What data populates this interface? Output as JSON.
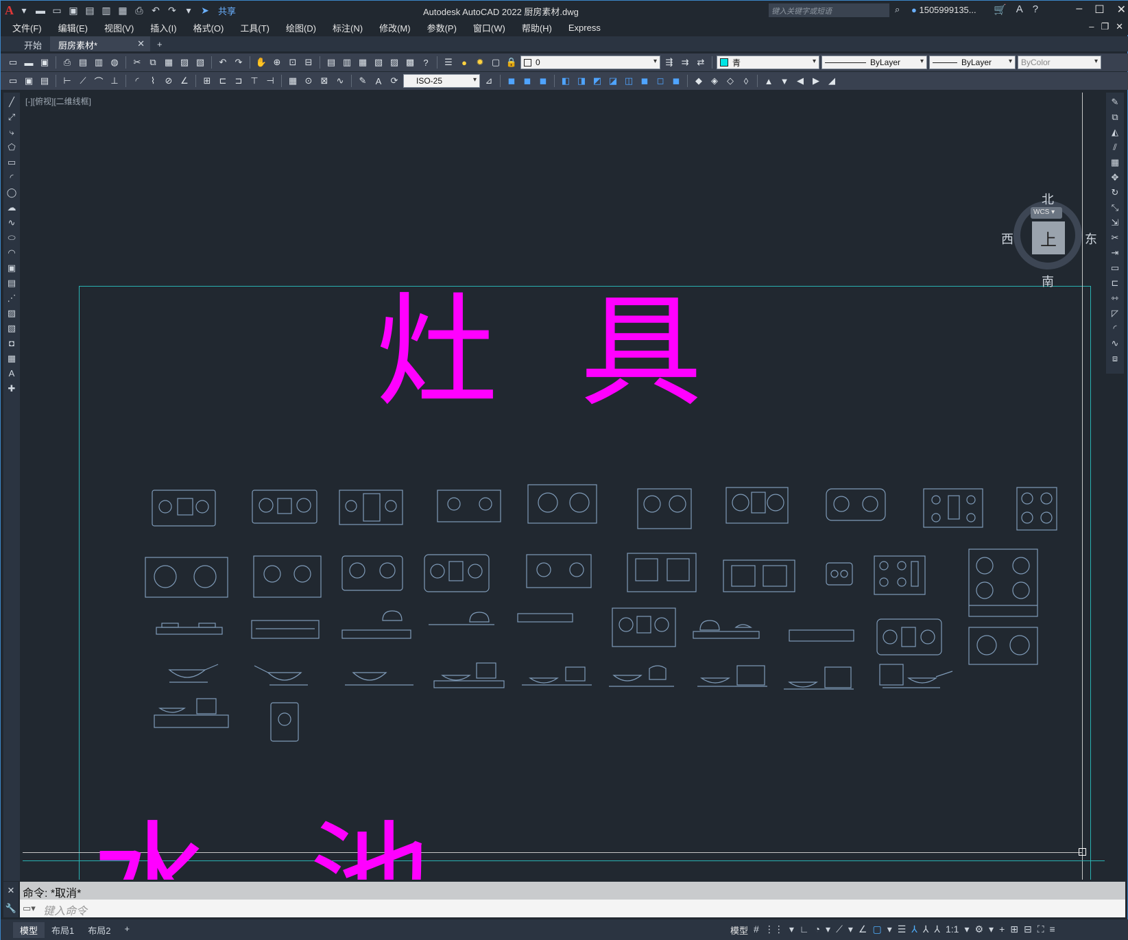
{
  "titlebar": {
    "logo": "A",
    "share_label": "共享",
    "app_title": "Autodesk AutoCAD 2022    厨房素材.dwg",
    "search_placeholder": "键入关键字或短语",
    "user": "1505999135...",
    "quick_access_icons": [
      "new-icon",
      "open-icon",
      "save-icon",
      "saveas-icon",
      "plot-preview-icon",
      "publish-icon",
      "print-icon",
      "undo-icon",
      "redo-icon"
    ]
  },
  "menu": {
    "items": [
      "文件(F)",
      "编辑(E)",
      "视图(V)",
      "插入(I)",
      "格式(O)",
      "工具(T)",
      "绘图(D)",
      "标注(N)",
      "修改(M)",
      "参数(P)",
      "窗口(W)",
      "帮助(H)",
      "Express"
    ]
  },
  "filetabs": {
    "start": "开始",
    "active": "厨房素材*"
  },
  "toolbar": {
    "layer_value": "0",
    "color_value": "青",
    "linetype_value": "ByLayer",
    "lineweight_value": "ByLayer",
    "plotstyle_value": "ByColor",
    "dimstyle_value": "ISO-25"
  },
  "viewport": {
    "label": "[-][俯视][二维线框]",
    "title_top": "灶具",
    "title_bottom": "水池"
  },
  "viewcube": {
    "north": "北",
    "south": "南",
    "west": "西",
    "east": "东",
    "face": "上",
    "wcs": "WCS"
  },
  "command": {
    "history": "命令: *取消*",
    "placeholder": "键入命令"
  },
  "statusbar": {
    "tabs": [
      "模型",
      "布局1",
      "布局2"
    ],
    "model_label": "模型",
    "scale": "1:1"
  },
  "colors": {
    "title_text": "#ff00ff",
    "frame": "#2ab3b3",
    "symbols": "#7f9bb8",
    "background": "#212830"
  }
}
